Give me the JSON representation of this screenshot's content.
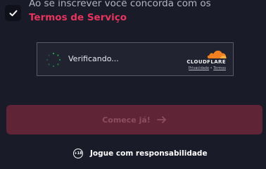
{
  "consent": {
    "checked": true,
    "text": "Ao se inscrever você concorda com os",
    "terms_label": "Termos de Serviço"
  },
  "captcha": {
    "status": "Verificando...",
    "provider": "CLOUDFLARE",
    "privacy_label": "Privacidade",
    "separator": " • ",
    "terms_label": "Termos"
  },
  "submit": {
    "label": "Comece já!"
  },
  "responsible": {
    "age_badge": "+18",
    "label": "Jogue com responsabilidade"
  },
  "colors": {
    "background": "#1a1b29",
    "accent": "#e5345d",
    "button_disabled": "#602437"
  }
}
